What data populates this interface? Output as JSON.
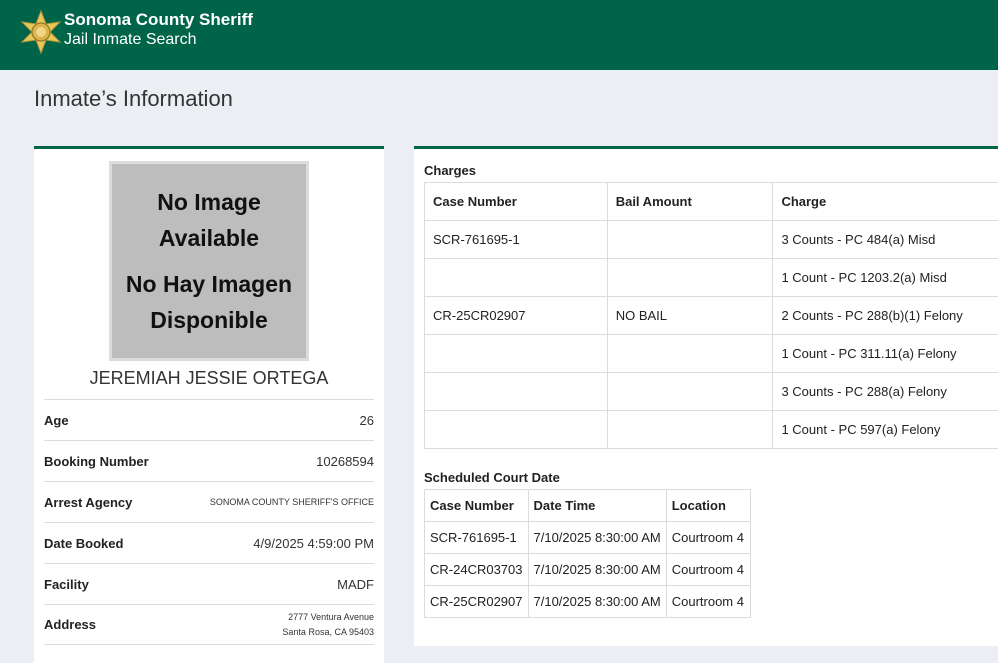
{
  "header": {
    "title": "Sonoma County Sheriff",
    "subtitle": "Jail Inmate Search"
  },
  "page": {
    "title": "Inmate’s Information"
  },
  "inmate": {
    "photo_text": [
      "No Image",
      "Available",
      "No Hay Imagen",
      "Disponible"
    ],
    "name": "JEREMIAH JESSIE ORTEGA",
    "fields": [
      {
        "label": "Age",
        "value": "26"
      },
      {
        "label": "Booking Number",
        "value": "10268594"
      },
      {
        "label": "Arrest Agency",
        "value": "SONOMA COUNTY SHERIFF'S OFFICE"
      },
      {
        "label": "Date Booked",
        "value": "4/9/2025 4:59:00 PM"
      },
      {
        "label": "Facility",
        "value": "MADF"
      },
      {
        "label": "Address",
        "value_line1": "2777 Ventura Avenue",
        "value_line2": "Santa Rosa, CA 95403"
      }
    ]
  },
  "charges": {
    "title": "Charges",
    "headers": [
      "Case Number",
      "Bail Amount",
      "Charge"
    ],
    "rows": [
      [
        "SCR-761695-1",
        "",
        "3 Counts - PC 484(a) Misd"
      ],
      [
        "",
        "",
        "1 Count - PC 1203.2(a) Misd"
      ],
      [
        "CR-25CR02907",
        "NO BAIL",
        "2 Counts - PC 288(b)(1) Felony"
      ],
      [
        "",
        "",
        "1 Count - PC 311.11(a) Felony"
      ],
      [
        "",
        "",
        "3 Counts - PC 288(a) Felony"
      ],
      [
        "",
        "",
        "1 Count - PC 597(a) Felony"
      ]
    ]
  },
  "court": {
    "title": "Scheduled Court Date",
    "headers": [
      "Case Number",
      "Date Time",
      "Location"
    ],
    "rows": [
      [
        "SCR-761695-1",
        "7/10/2025 8:30:00 AM",
        "Courtroom 4"
      ],
      [
        "CR-24CR03703",
        "7/10/2025 8:30:00 AM",
        "Courtroom 4"
      ],
      [
        "CR-25CR02907",
        "7/10/2025 8:30:00 AM",
        "Courtroom 4"
      ]
    ]
  },
  "colors": {
    "brand": "#006548",
    "badge": "#e8c75a"
  },
  "icons": {
    "logo": "sheriff-star-icon"
  }
}
